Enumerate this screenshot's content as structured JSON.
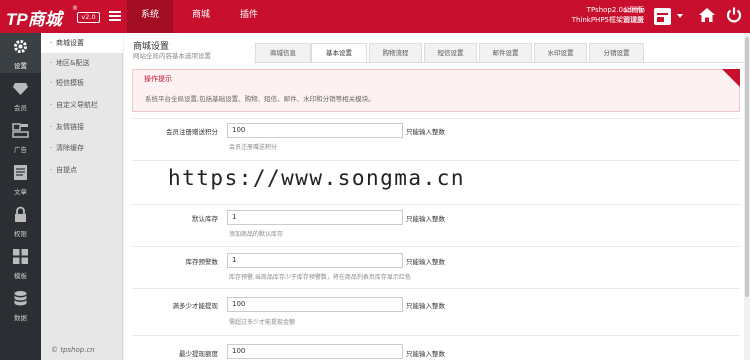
{
  "topbar": {
    "logo": "TP商城",
    "logo_mark": "®",
    "version": "v2.0",
    "nav": [
      "系统",
      "商城",
      "插件"
    ],
    "shop_name": "TPshop2.0公测版",
    "shop_sub": "ThinkPHP5框架测试版",
    "user": "admin",
    "role": "管理员"
  },
  "sidebar": {
    "items": [
      {
        "label": "设置",
        "icon": "gear-icon"
      },
      {
        "label": "会员",
        "icon": "diamond-icon"
      },
      {
        "label": "广告",
        "icon": "ad-icon"
      },
      {
        "label": "文章",
        "icon": "article-icon"
      },
      {
        "label": "权限",
        "icon": "lock-icon"
      },
      {
        "label": "模板",
        "icon": "grid-icon"
      },
      {
        "label": "数据",
        "icon": "database-icon"
      }
    ]
  },
  "submenu": {
    "items": [
      "商城设置",
      "地区&配送",
      "短信模板",
      "自定义导航栏",
      "友情链接",
      "清除缓存",
      "自提点"
    ],
    "copyright": "© tpshop.cn"
  },
  "main": {
    "title": "商城设置",
    "subtitle": "网站全局内容基本选项设置",
    "tabs": [
      "商城信息",
      "基本设置",
      "购物流程",
      "短信设置",
      "邮件设置",
      "水印设置",
      "分销设置"
    ],
    "tips_title": "操作提示",
    "tips_body": "系统平台全局设置,包括基础设置、购物、短信、邮件、水印和分销等相关模块。",
    "fields": [
      {
        "label": "会员注册赠送积分",
        "value": "100",
        "unit": "只能输入整数",
        "hint": "会员注册赠送积分"
      },
      {
        "label": "",
        "value": "",
        "unit": "",
        "hint": ""
      },
      {
        "label": "默认库存",
        "value": "1",
        "unit": "只能输入整数",
        "hint": "添加商品的默认库存"
      },
      {
        "label": "库存预警数",
        "value": "1",
        "unit": "只能输入整数",
        "hint": "库存预警,当商品库存少于库存预警数，将在商品列表页库存显示红色"
      },
      {
        "label": "满多少才能提现",
        "value": "100",
        "unit": "只能输入整数",
        "hint": "需超过多少才能提现金额"
      },
      {
        "label": "最少提现额度",
        "value": "100",
        "unit": "只能输入整数",
        "hint": ""
      }
    ]
  },
  "watermark": "https://www.songma.cn",
  "colors": {
    "brand": "#c8102e",
    "sidebar": "#2b2f33"
  }
}
